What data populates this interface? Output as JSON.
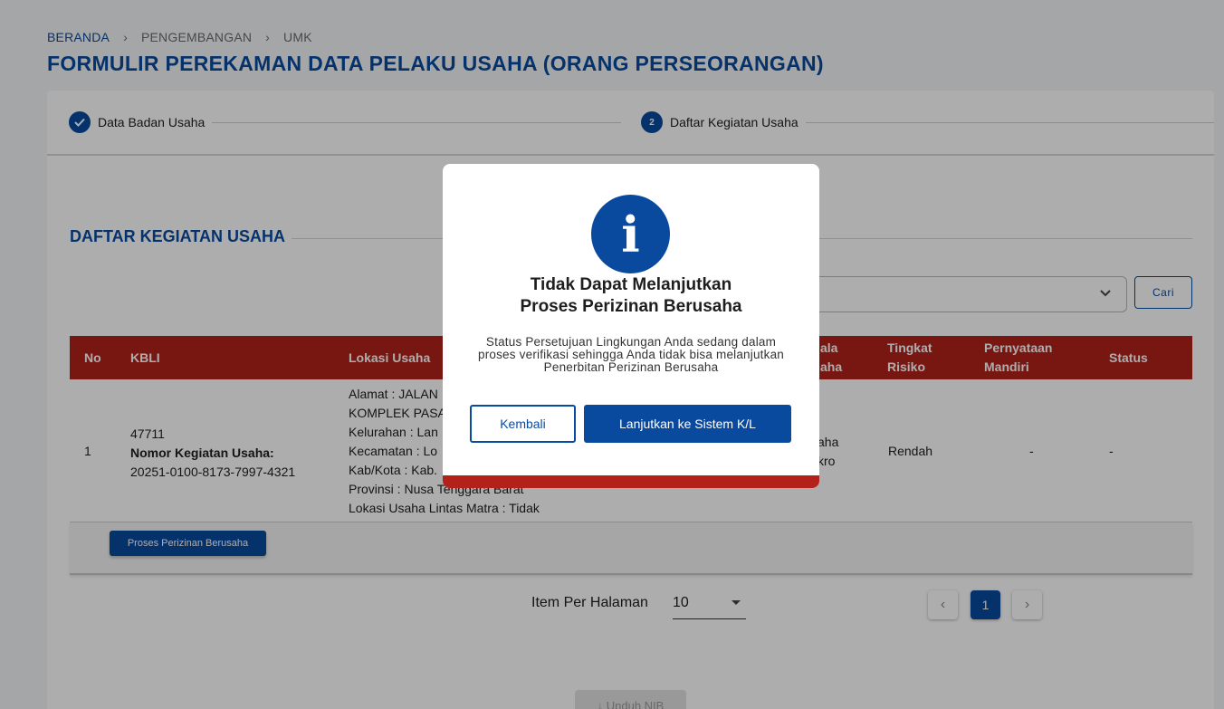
{
  "breadcrumb": {
    "items": [
      "BERANDA",
      "PENGEMBANGAN",
      "UMK"
    ],
    "separator": "›"
  },
  "page_title": "FORMULIR PEREKAMAN DATA PELAKU USAHA (ORANG PERSEORANGAN)",
  "stepper": {
    "step1": {
      "label": "Data Badan Usaha",
      "icon": "check-icon"
    },
    "step2": {
      "number": "2",
      "label": "Daftar Kegiatan Usaha"
    }
  },
  "section_title": "DAFTAR KEGIATAN USAHA",
  "search": {
    "button_label": "Cari"
  },
  "table": {
    "headers": {
      "no": "No",
      "kbli": "KBLI",
      "lokasi": "Lokasi Usaha",
      "skala": "ala\naha",
      "risiko": "Tingkat\nRisiko",
      "pernyataan": "Pernyataan\nMandiri",
      "status": "Status"
    },
    "row": {
      "no": "1",
      "kbli_code": "47711",
      "nomor_label": "Nomor Kegiatan Usaha:",
      "nomor_value": "20251-0100-8173-7997-4321",
      "lokasi": [
        "Alamat : JALAN",
        "KOMPLEK PASA",
        "Kelurahan : Lan",
        "Kecamatan : Lo",
        "Kab/Kota : Kab.",
        "Provinsi : Nusa Tenggara Barat",
        "Lokasi Usaha Lintas Matra : Tidak"
      ],
      "skala": "aha\nkro",
      "risiko": "Rendah",
      "pernyataan": "-",
      "status": "-"
    },
    "proses_button": "Proses Perizinan Berusaha"
  },
  "pagination": {
    "label": "Item Per Halaman",
    "per_page": "10",
    "current_page": "1",
    "prev": "‹",
    "next": "›"
  },
  "unduh_button": "↓ Unduh NIB",
  "modal": {
    "icon": "info-icon",
    "icon_glyph": "i",
    "title_line1": "Tidak Dapat Melanjutkan",
    "title_line2": "Proses Perizinan Berusaha",
    "message": "Status Persetujuan Lingkungan Anda sedang dalam proses verifikasi sehingga Anda tidak bisa melanjutkan Penerbitan Perizinan Berusaha",
    "btn_back": "Kembali",
    "btn_continue": "Lanjutkan ke Sistem K/L"
  },
  "colors": {
    "primary": "#0a4a9e",
    "header_red": "#b2221b"
  }
}
